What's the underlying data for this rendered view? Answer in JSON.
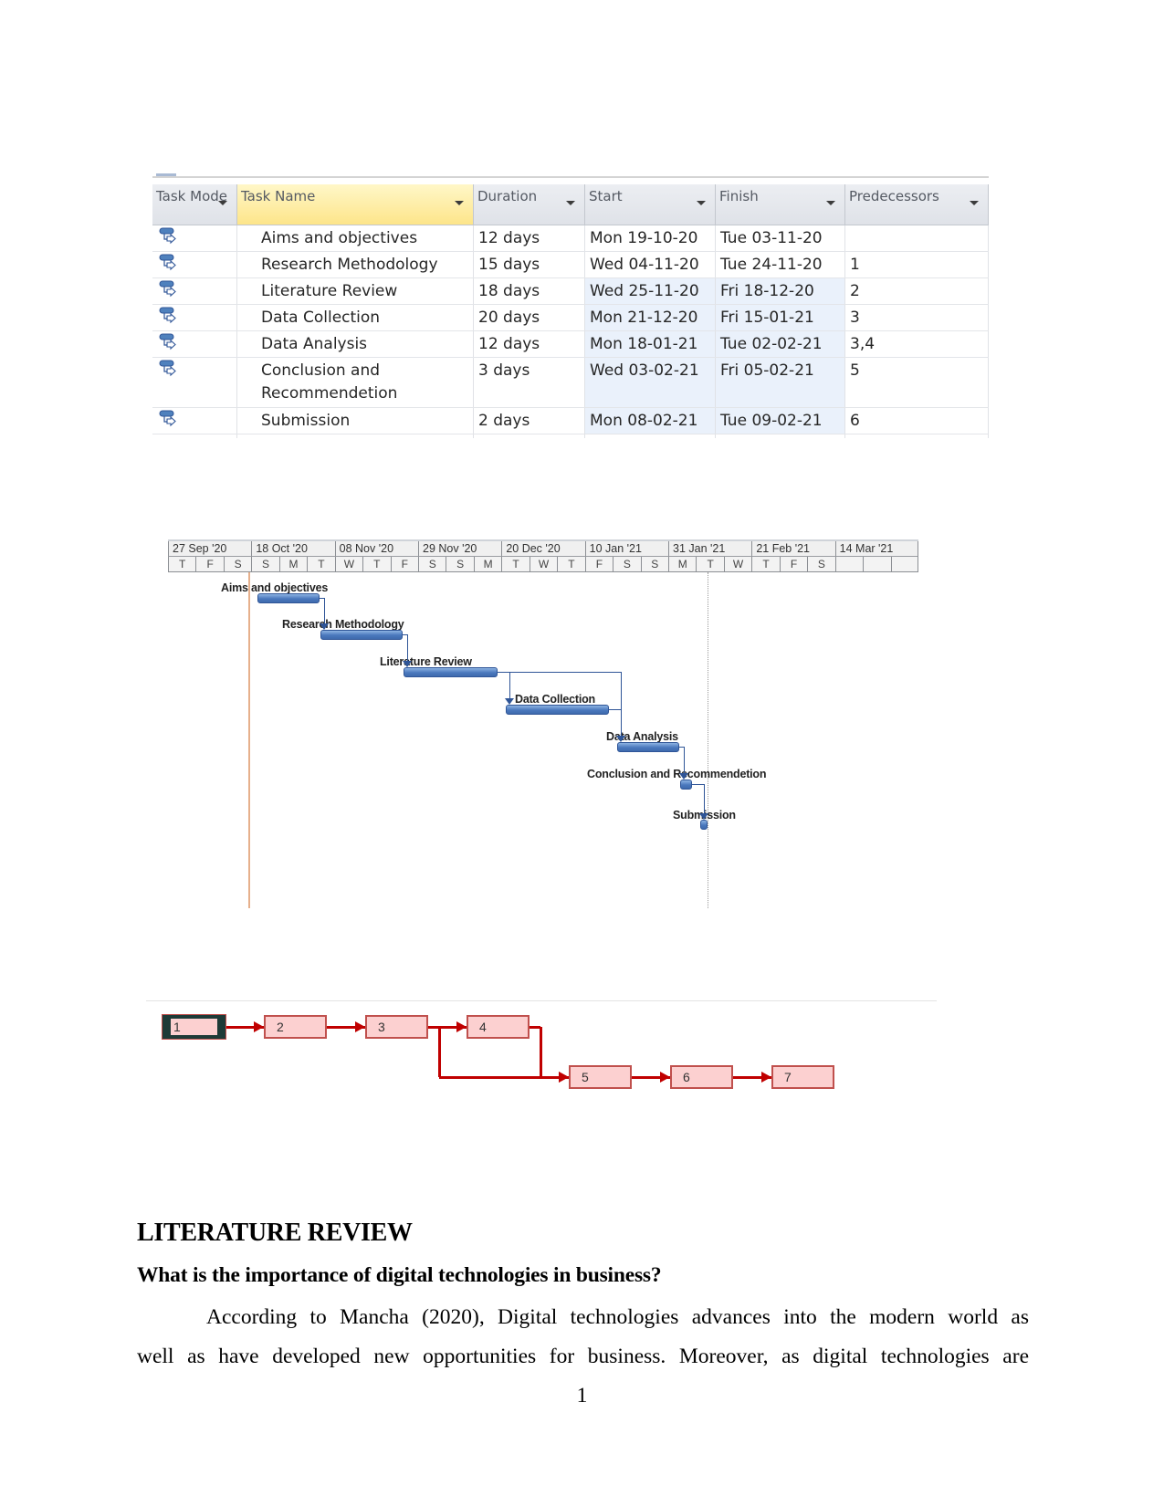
{
  "task_table": {
    "headers": {
      "task_mode": "Task Mode",
      "task_name": "Task Name",
      "duration": "Duration",
      "start": "Start",
      "finish": "Finish",
      "predecessors": "Predecessors"
    },
    "task_mode_icon": "auto-scheduled-task-icon",
    "rows": [
      {
        "name": "Aims and objectives",
        "duration": "12 days",
        "start": "Mon 19-10-20",
        "finish": "Tue 03-11-20",
        "predecessors": ""
      },
      {
        "name": "Research Methodology",
        "duration": "15 days",
        "start": "Wed 04-11-20",
        "finish": "Tue 24-11-20",
        "predecessors": "1"
      },
      {
        "name": "Literature Review",
        "duration": "18 days",
        "start": "Wed 25-11-20",
        "finish": "Fri 18-12-20",
        "predecessors": "2"
      },
      {
        "name": "Data Collection",
        "duration": "20 days",
        "start": "Mon 21-12-20",
        "finish": "Fri 15-01-21",
        "predecessors": "3"
      },
      {
        "name": "Data Analysis",
        "duration": "12 days",
        "start": "Mon 18-01-21",
        "finish": "Tue 02-02-21",
        "predecessors": "3,4"
      },
      {
        "name": "Conclusion and Recommendetion",
        "duration": "3 days",
        "start": "Wed 03-02-21",
        "finish": "Fri 05-02-21",
        "predecessors": "5"
      },
      {
        "name": "Submission",
        "duration": "2 days",
        "start": "Mon 08-02-21",
        "finish": "Tue 09-02-21",
        "predecessors": "6"
      }
    ]
  },
  "gantt": {
    "major_scale": [
      "27 Sep '20",
      "18 Oct '20",
      "08 Nov '20",
      "29 Nov '20",
      "20 Dec '20",
      "10 Jan '21",
      "31 Jan '21",
      "21 Feb '21",
      "14 Mar '21"
    ],
    "minor_scale": [
      "T",
      "F",
      "S",
      "S",
      "M",
      "T",
      "W",
      "T",
      "F",
      "S",
      "S",
      "M",
      "T",
      "W",
      "T",
      "F",
      "S",
      "S",
      "M",
      "T",
      "W",
      "T",
      "F",
      "S"
    ],
    "colors": {
      "bar": "#4a78bd",
      "link": "#2f5597",
      "today_line": "#e6b08c"
    },
    "tasks": [
      {
        "label": "Aims and objectives"
      },
      {
        "label": "Research Methodology"
      },
      {
        "label": "Literature Review"
      },
      {
        "label": "Data Collection"
      },
      {
        "label": "Data Analysis"
      },
      {
        "label": "Conclusion and Recommendetion"
      },
      {
        "label": "Submission"
      }
    ]
  },
  "network": {
    "nodes": [
      "1",
      "2",
      "3",
      "4",
      "5",
      "6",
      "7"
    ],
    "selected_node": "1",
    "edges": [
      [
        "1",
        "2"
      ],
      [
        "2",
        "3"
      ],
      [
        "3",
        "4"
      ],
      [
        "3",
        "5"
      ],
      [
        "4",
        "5"
      ],
      [
        "5",
        "6"
      ],
      [
        "6",
        "7"
      ]
    ],
    "colors": {
      "box_fill": "#fcd0d0",
      "box_border": "#c0504d",
      "link": "#c00000"
    }
  },
  "document": {
    "heading": "LITERATURE REVIEW",
    "question": "What is the importance of digital technologies in business?",
    "paragraph_line1": "According to Mancha (2020), Digital technologies advances into the modern world as",
    "paragraph_line2": "well as have developed new opportunities for business. Moreover, as digital technologies are",
    "page_number": "1"
  }
}
